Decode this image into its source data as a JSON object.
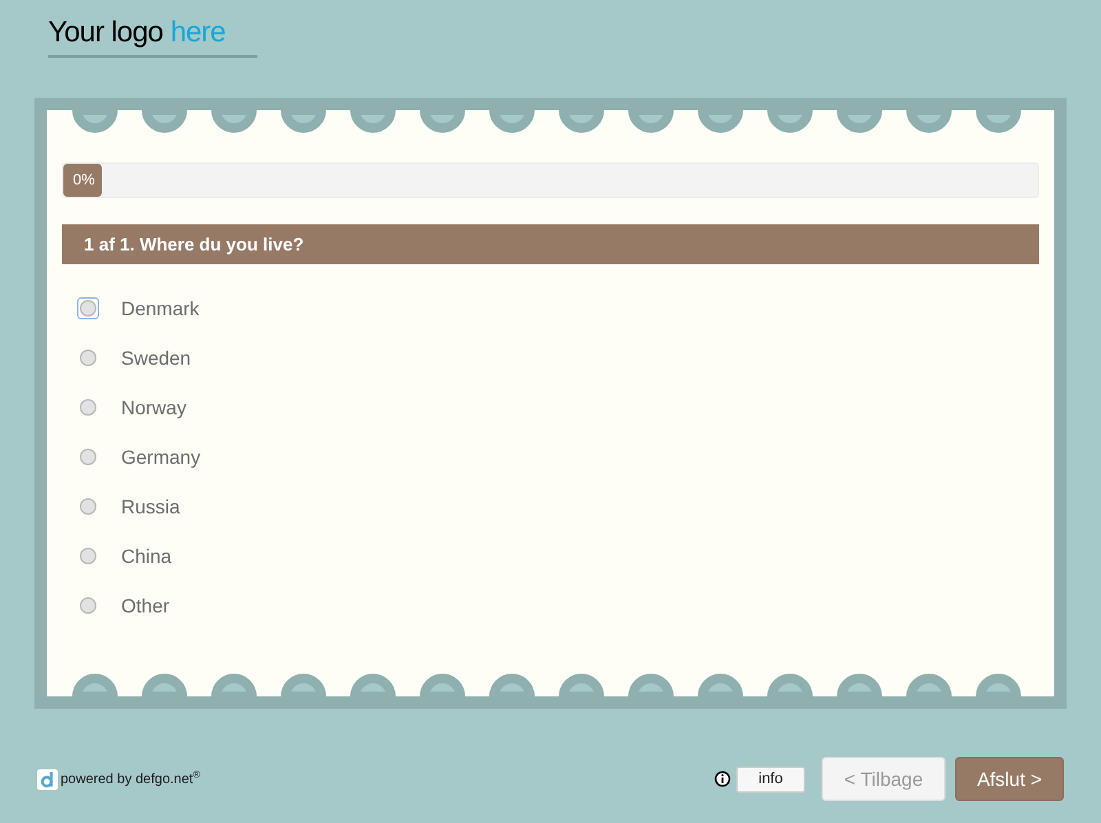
{
  "logo": {
    "text": "Your logo",
    "accent": "here"
  },
  "progress": {
    "label": "0%",
    "level": 0
  },
  "question": {
    "title": "1 af 1. Where du you live?",
    "options": [
      {
        "label": "Denmark",
        "selected": false,
        "focused": true
      },
      {
        "label": "Sweden",
        "selected": false,
        "focused": false
      },
      {
        "label": "Norway",
        "selected": false,
        "focused": false
      },
      {
        "label": "Germany",
        "selected": false,
        "focused": false
      },
      {
        "label": "Russia",
        "selected": false,
        "focused": false
      },
      {
        "label": "China",
        "selected": false,
        "focused": false
      },
      {
        "label": "Other",
        "selected": false,
        "focused": false
      }
    ]
  },
  "footer": {
    "powered_by": "powered by defgo.net",
    "mark": "®",
    "info_button": "info",
    "back_button": "< Tilbage",
    "next_button": "Afslut >"
  }
}
